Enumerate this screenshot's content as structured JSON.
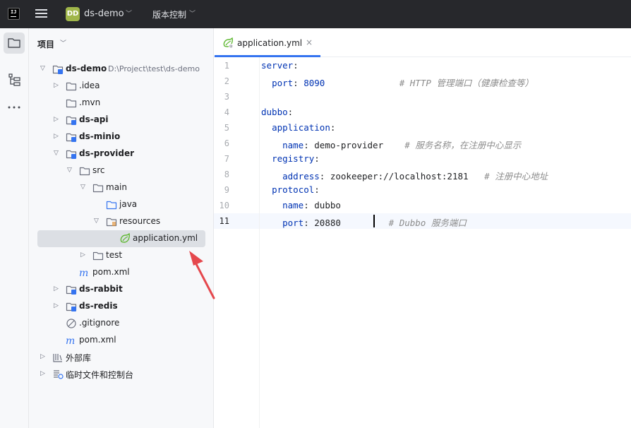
{
  "titlebar": {
    "logo": "IJ",
    "project_badge": "DD",
    "project_name": "ds-demo",
    "vcs_label": "版本控制"
  },
  "toolstrip": {
    "icons": [
      "folder-icon",
      "structure-icon",
      "more-icon"
    ]
  },
  "project_panel": {
    "title": "项目",
    "tree": [
      {
        "label": "ds-demo",
        "path": "D:\\Project\\test\\ds-demo",
        "expanded": true,
        "bold": true,
        "icon": "module-icon"
      },
      {
        "label": ".idea",
        "expanded": false,
        "bold": false,
        "icon": "folder-icon"
      },
      {
        "label": ".mvn",
        "bold": false,
        "icon": "folder-icon"
      },
      {
        "label": "ds-api",
        "expanded": false,
        "bold": true,
        "icon": "module-icon"
      },
      {
        "label": "ds-minio",
        "expanded": false,
        "bold": true,
        "icon": "module-icon"
      },
      {
        "label": "ds-provider",
        "expanded": true,
        "bold": true,
        "icon": "module-icon"
      },
      {
        "label": "src",
        "expanded": true,
        "bold": false,
        "icon": "folder-icon"
      },
      {
        "label": "main",
        "expanded": true,
        "bold": false,
        "icon": "folder-icon"
      },
      {
        "label": "java",
        "bold": false,
        "icon": "source-folder-icon"
      },
      {
        "label": "resources",
        "expanded": true,
        "bold": false,
        "icon": "resources-folder-icon"
      },
      {
        "label": "application.yml",
        "bold": false,
        "icon": "spring-yaml-icon",
        "selected": true
      },
      {
        "label": "test",
        "expanded": false,
        "bold": false,
        "icon": "folder-icon"
      },
      {
        "label": "pom.xml",
        "bold": false,
        "icon": "maven-icon"
      },
      {
        "label": "ds-rabbit",
        "expanded": false,
        "bold": true,
        "icon": "module-icon"
      },
      {
        "label": "ds-redis",
        "expanded": false,
        "bold": true,
        "icon": "module-icon"
      },
      {
        "label": ".gitignore",
        "bold": false,
        "icon": "ignore-icon"
      },
      {
        "label": "pom.xml",
        "bold": false,
        "icon": "maven-icon"
      },
      {
        "label": "外部库",
        "expanded": false,
        "bold": false,
        "icon": "library-icon"
      },
      {
        "label": "临时文件和控制台",
        "expanded": false,
        "bold": false,
        "icon": "scratches-icon"
      }
    ]
  },
  "editor": {
    "tab": {
      "label": "application.yml",
      "close": "×"
    },
    "lines": [
      {
        "n": "1",
        "parts": [
          [
            "k",
            "server"
          ],
          [
            "p",
            ":"
          ]
        ]
      },
      {
        "n": "2",
        "parts": [
          [
            "s",
            "  "
          ],
          [
            "k",
            "port"
          ],
          [
            "p",
            ": "
          ],
          [
            "k",
            "8090"
          ],
          [
            "s",
            "              "
          ],
          [
            "c",
            "# HTTP 管理端口（健康检查等）"
          ]
        ]
      },
      {
        "n": "3",
        "parts": []
      },
      {
        "n": "4",
        "parts": [
          [
            "k",
            "dubbo"
          ],
          [
            "p",
            ":"
          ]
        ]
      },
      {
        "n": "5",
        "parts": [
          [
            "s",
            "  "
          ],
          [
            "k",
            "application"
          ],
          [
            "p",
            ":"
          ]
        ]
      },
      {
        "n": "6",
        "parts": [
          [
            "s",
            "    "
          ],
          [
            "k",
            "name"
          ],
          [
            "p",
            ": demo-provider    "
          ],
          [
            "c",
            "# 服务名称，在注册中心显示"
          ]
        ]
      },
      {
        "n": "7",
        "parts": [
          [
            "s",
            "  "
          ],
          [
            "k",
            "registry"
          ],
          [
            "p",
            ":"
          ]
        ]
      },
      {
        "n": "8",
        "parts": [
          [
            "s",
            "    "
          ],
          [
            "k",
            "address"
          ],
          [
            "p",
            ": zookeeper://localhost:2181   "
          ],
          [
            "c",
            "# 注册中心地址"
          ]
        ]
      },
      {
        "n": "9",
        "parts": [
          [
            "s",
            "  "
          ],
          [
            "k",
            "protocol"
          ],
          [
            "p",
            ":"
          ]
        ]
      },
      {
        "n": "10",
        "parts": [
          [
            "s",
            "    "
          ],
          [
            "k",
            "name"
          ],
          [
            "p",
            ": dubbo"
          ]
        ]
      },
      {
        "n": "11",
        "parts": [
          [
            "s",
            "    "
          ],
          [
            "k",
            "port"
          ],
          [
            "p",
            ": 20880         "
          ],
          [
            "c",
            "# Dubbo 服务端口"
          ]
        ]
      }
    ],
    "current_line": "11"
  },
  "colors": {
    "titlebar_bg": "#27282c",
    "accent": "#3574f0",
    "yaml_key": "#0033b3",
    "comment": "#8c8c8c",
    "arrow": "#e5484d"
  }
}
